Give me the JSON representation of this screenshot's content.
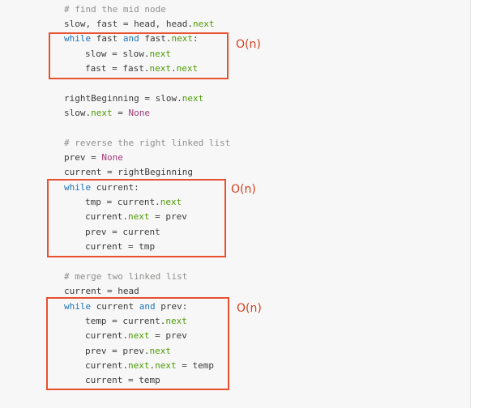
{
  "code": {
    "l1": [
      {
        "t": "# find the mid node",
        "c": "cm"
      }
    ],
    "l2": [
      {
        "t": "slow, fast = head, head."
      },
      {
        "t": "next",
        "c": "at"
      }
    ],
    "l3": [
      {
        "t": "while",
        "c": "kw"
      },
      {
        "t": " fast "
      },
      {
        "t": "and",
        "c": "kw"
      },
      {
        "t": " fast."
      },
      {
        "t": "next",
        "c": "at"
      },
      {
        "t": ":"
      }
    ],
    "l4": [
      {
        "t": "slow = slow."
      },
      {
        "t": "next",
        "c": "at"
      }
    ],
    "l5": [
      {
        "t": "fast = fast."
      },
      {
        "t": "next",
        "c": "at"
      },
      {
        "t": "."
      },
      {
        "t": "next",
        "c": "at"
      }
    ],
    "l6": [
      {
        "t": "rightBeginning = slow."
      },
      {
        "t": "next",
        "c": "at"
      }
    ],
    "l7": [
      {
        "t": "slow."
      },
      {
        "t": "next",
        "c": "at"
      },
      {
        "t": " = "
      },
      {
        "t": "None",
        "c": "nn"
      }
    ],
    "l8": [
      {
        "t": "# reverse the right linked list",
        "c": "cm"
      }
    ],
    "l9": [
      {
        "t": "prev = "
      },
      {
        "t": "None",
        "c": "nn"
      }
    ],
    "l10": [
      {
        "t": "current = rightBeginning"
      }
    ],
    "l11": [
      {
        "t": "while",
        "c": "kw"
      },
      {
        "t": " current:"
      }
    ],
    "l12": [
      {
        "t": "tmp = current."
      },
      {
        "t": "next",
        "c": "at"
      }
    ],
    "l13": [
      {
        "t": "current."
      },
      {
        "t": "next",
        "c": "at"
      },
      {
        "t": " = prev"
      }
    ],
    "l14": [
      {
        "t": "prev = current"
      }
    ],
    "l15": [
      {
        "t": "current = tmp"
      }
    ],
    "l16": [
      {
        "t": "# merge two linked list",
        "c": "cm"
      }
    ],
    "l17": [
      {
        "t": "current = head"
      }
    ],
    "l18": [
      {
        "t": "while",
        "c": "kw"
      },
      {
        "t": " current "
      },
      {
        "t": "and",
        "c": "kw"
      },
      {
        "t": " prev:"
      }
    ],
    "l19": [
      {
        "t": "temp = current."
      },
      {
        "t": "next",
        "c": "at"
      }
    ],
    "l20": [
      {
        "t": "current."
      },
      {
        "t": "next",
        "c": "at"
      },
      {
        "t": " = prev"
      }
    ],
    "l21": [
      {
        "t": "prev = prev."
      },
      {
        "t": "next",
        "c": "at"
      }
    ],
    "l22": [
      {
        "t": "current."
      },
      {
        "t": "next",
        "c": "at"
      },
      {
        "t": "."
      },
      {
        "t": "next",
        "c": "at"
      },
      {
        "t": " = temp"
      }
    ],
    "l23": [
      {
        "t": "current = temp"
      }
    ]
  },
  "annotations": {
    "a1": "O(n)",
    "a2": "O(n)",
    "a3": "O(n)"
  },
  "colors": {
    "comment": "#8e908c",
    "keyword": "#1f74b5",
    "attribute": "#4e9a06",
    "none_constant": "#a03a7a",
    "text": "#3b3b3b",
    "highlight_box": "#e8502f",
    "annotation": "#d2401f",
    "background": "#f7f7f7"
  }
}
